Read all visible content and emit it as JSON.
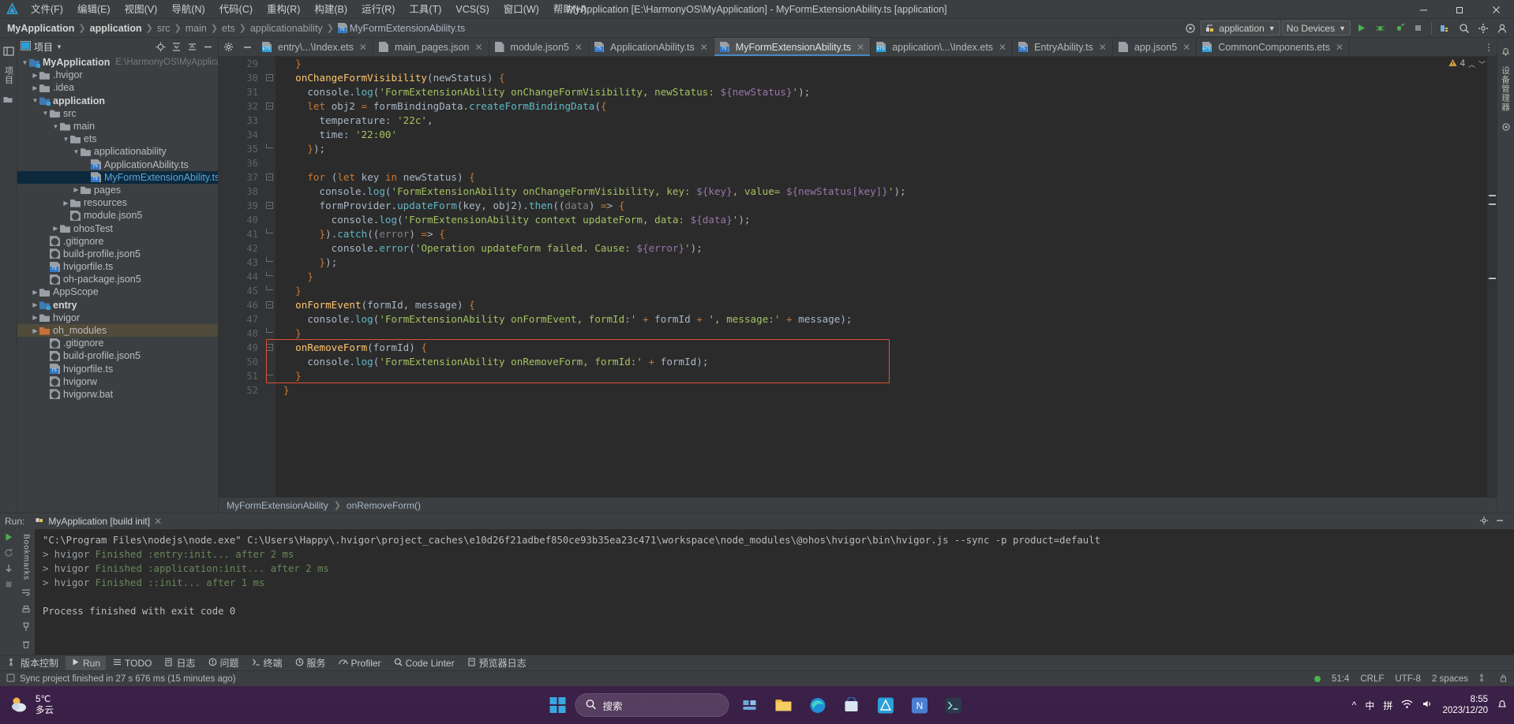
{
  "menu": {
    "logo_icon": "deveco-logo-icon",
    "items": [
      "文件(F)",
      "编辑(E)",
      "视图(V)",
      "导航(N)",
      "代码(C)",
      "重构(R)",
      "构建(B)",
      "运行(R)",
      "工具(T)",
      "VCS(S)",
      "窗口(W)",
      "帮助(H)"
    ],
    "window_title": "MyApplication [E:\\HarmonyOS\\MyApplication] - MyFormExtensionAbility.ts [application]",
    "controls": {
      "minimize": "—",
      "maximize": "❐",
      "close": "✕"
    }
  },
  "navbar": {
    "breadcrumbs": [
      {
        "label": "MyApplication",
        "style": "bold"
      },
      {
        "label": "application",
        "style": "bold"
      },
      {
        "label": "src",
        "style": "dim"
      },
      {
        "label": "main",
        "style": "dim"
      },
      {
        "label": "ets",
        "style": "dim"
      },
      {
        "label": "applicationability",
        "style": "dim"
      },
      {
        "label": "MyFormExtensionAbility.ts",
        "style": "file"
      }
    ],
    "separator": "❯",
    "settings_icon": "gear-toolbar-icon",
    "run_config": "application",
    "device_select": "No Devices",
    "actions": [
      "run-icon",
      "debug-icon",
      "profile-icon",
      "stop-icon",
      "device-manager-icon",
      "search-everywhere-icon",
      "settings-icon",
      "account-icon"
    ]
  },
  "left_rail": {
    "project_tab": "项目",
    "structure_icon": "structure-icon"
  },
  "project": {
    "title": "项目",
    "dropdown_icon": "chevron-down-icon",
    "head_actions": [
      "locate-file-icon",
      "expand-all-icon",
      "collapse-all-icon",
      "hide-icon"
    ],
    "tree": [
      {
        "depth": 0,
        "arrow": "v",
        "type": "folder-module",
        "label": "MyApplication",
        "bold": true,
        "path": "E:\\HarmonyOS\\MyApplication"
      },
      {
        "depth": 1,
        "arrow": ">",
        "type": "folder",
        "label": ".hvigor"
      },
      {
        "depth": 1,
        "arrow": ">",
        "type": "folder",
        "label": ".idea"
      },
      {
        "depth": 1,
        "arrow": "v",
        "type": "folder-module",
        "label": "application",
        "bold": true
      },
      {
        "depth": 2,
        "arrow": "v",
        "type": "folder",
        "label": "src"
      },
      {
        "depth": 3,
        "arrow": "v",
        "type": "folder",
        "label": "main"
      },
      {
        "depth": 4,
        "arrow": "v",
        "type": "folder",
        "label": "ets"
      },
      {
        "depth": 5,
        "arrow": "v",
        "type": "folder",
        "label": "applicationability"
      },
      {
        "depth": 6,
        "arrow": "",
        "type": "ts",
        "label": "ApplicationAbility.ts"
      },
      {
        "depth": 6,
        "arrow": "",
        "type": "ts",
        "label": "MyFormExtensionAbility.ts",
        "selected": true
      },
      {
        "depth": 5,
        "arrow": ">",
        "type": "folder",
        "label": "pages"
      },
      {
        "depth": 4,
        "arrow": ">",
        "type": "folder",
        "label": "resources"
      },
      {
        "depth": 4,
        "arrow": "",
        "type": "json",
        "label": "module.json5"
      },
      {
        "depth": 3,
        "arrow": ">",
        "type": "folder",
        "label": "ohosTest"
      },
      {
        "depth": 2,
        "arrow": "",
        "type": "json",
        "label": ".gitignore"
      },
      {
        "depth": 2,
        "arrow": "",
        "type": "json",
        "label": "build-profile.json5"
      },
      {
        "depth": 2,
        "arrow": "",
        "type": "ts",
        "label": "hvigorfile.ts"
      },
      {
        "depth": 2,
        "arrow": "",
        "type": "json",
        "label": "oh-package.json5"
      },
      {
        "depth": 1,
        "arrow": ">",
        "type": "folder",
        "label": "AppScope"
      },
      {
        "depth": 1,
        "arrow": ">",
        "type": "folder-module",
        "label": "entry",
        "bold": true
      },
      {
        "depth": 1,
        "arrow": ">",
        "type": "folder",
        "label": "hvigor"
      },
      {
        "depth": 1,
        "arrow": ">",
        "type": "folder-orange",
        "label": "oh_modules",
        "selected2": true
      },
      {
        "depth": 2,
        "arrow": "",
        "type": "json",
        "label": ".gitignore"
      },
      {
        "depth": 2,
        "arrow": "",
        "type": "json",
        "label": "build-profile.json5"
      },
      {
        "depth": 2,
        "arrow": "",
        "type": "ts",
        "label": "hvigorfile.ts"
      },
      {
        "depth": 2,
        "arrow": "",
        "type": "json",
        "label": "hvigorw"
      },
      {
        "depth": 2,
        "arrow": "",
        "type": "json",
        "label": "hvigorw.bat"
      }
    ]
  },
  "editor": {
    "tab_ctl_icons": [
      "gear-icon",
      "minimize-icon"
    ],
    "tabs": [
      {
        "label": "entry\\...\\Index.ets",
        "icon": "ets",
        "active": false
      },
      {
        "label": "main_pages.json",
        "icon": "json",
        "active": false
      },
      {
        "label": "module.json5",
        "icon": "json",
        "active": false
      },
      {
        "label": "ApplicationAbility.ts",
        "icon": "ts",
        "active": false
      },
      {
        "label": "MyFormExtensionAbility.ts",
        "icon": "ts",
        "active": true
      },
      {
        "label": "application\\...\\Index.ets",
        "icon": "ets",
        "active": false
      },
      {
        "label": "EntryAbility.ts",
        "icon": "ts",
        "active": false
      },
      {
        "label": "app.json5",
        "icon": "json",
        "active": false
      },
      {
        "label": "CommonComponents.ets",
        "icon": "ets",
        "active": false
      }
    ],
    "tab_more_icon": "more-vertical-icon",
    "warning_count": "4",
    "warning_icon": "warning-triangle-icon",
    "first_line_number": 29,
    "lines": [
      {
        "n": 29,
        "text": "  }",
        "fold": ""
      },
      {
        "n": 30,
        "text": "  onChangeFormVisibility(newStatus) {",
        "fold": "minus"
      },
      {
        "n": 31,
        "text": "    console.log('FormExtensionAbility onChangeFormVisibility, newStatus: ${newStatus}');",
        "fold": ""
      },
      {
        "n": 32,
        "text": "    let obj2 = formBindingData.createFormBindingData({",
        "fold": "minus"
      },
      {
        "n": 33,
        "text": "      temperature: '22c',",
        "fold": ""
      },
      {
        "n": 34,
        "text": "      time: '22:00'",
        "fold": ""
      },
      {
        "n": 35,
        "text": "    });",
        "fold": "end"
      },
      {
        "n": 36,
        "text": "",
        "fold": ""
      },
      {
        "n": 37,
        "text": "    for (let key in newStatus) {",
        "fold": "minus"
      },
      {
        "n": 38,
        "text": "      console.log('FormExtensionAbility onChangeFormVisibility, key: ${key}, value= ${newStatus[key]}');",
        "fold": ""
      },
      {
        "n": 39,
        "text": "      formProvider.updateForm(key, obj2).then((data) => {",
        "fold": "minus"
      },
      {
        "n": 40,
        "text": "        console.log('FormExtensionAbility context updateForm, data: ${data}');",
        "fold": ""
      },
      {
        "n": 41,
        "text": "      }).catch((error) => {",
        "fold": "end"
      },
      {
        "n": 42,
        "text": "        console.error('Operation updateForm failed. Cause: ${error}');",
        "fold": ""
      },
      {
        "n": 43,
        "text": "      });",
        "fold": "end"
      },
      {
        "n": 44,
        "text": "    }",
        "fold": "end"
      },
      {
        "n": 45,
        "text": "  }",
        "fold": "end"
      },
      {
        "n": 46,
        "text": "  onFormEvent(formId, message) {",
        "fold": "minus"
      },
      {
        "n": 47,
        "text": "    console.log('FormExtensionAbility onFormEvent, formId:' + formId + ', message:' + message);",
        "fold": ""
      },
      {
        "n": 48,
        "text": "  }",
        "fold": "end"
      },
      {
        "n": 49,
        "text": "  onRemoveForm(formId) {",
        "fold": "minus"
      },
      {
        "n": 50,
        "text": "    console.log('FormExtensionAbility onRemoveForm, formId:' + formId);",
        "fold": ""
      },
      {
        "n": 51,
        "text": "  }",
        "fold": "end"
      },
      {
        "n": 52,
        "text": "}",
        "fold": ""
      }
    ],
    "highlight_color": "#e0503a",
    "bottom_breadcrumb": [
      "MyFormExtensionAbility",
      "onRemoveForm()"
    ]
  },
  "right_rail": {
    "notifications_icon": "bell-icon",
    "labels": "设备管理器"
  },
  "run_panel": {
    "label": "Run:",
    "tab": "MyApplication [build init]",
    "tab_icon": "run-config-icon",
    "settings_icon": "gear-icon",
    "minimize_icon": "minimize-icon",
    "rail_icons": [
      "run-green-icon",
      "rerun-icon",
      "scroll-down-icon",
      "stop-icon",
      "wrap-icon",
      "print-icon",
      "pin-icon",
      "trash-icon"
    ],
    "console": [
      {
        "text": "\"C:\\Program Files\\nodejs\\node.exe\" C:\\Users\\Happy\\.hvigor\\project_caches\\e10d26f21adbef850ce93b35ea23c471\\workspace\\node_modules\\@ohos\\hvigor\\bin\\hvigor.js --sync -p product=default",
        "style": "plain"
      },
      {
        "text": "> hvigor Finished :entry:init... after 2 ms",
        "style": "green"
      },
      {
        "text": "> hvigor Finished :application:init... after 2 ms",
        "style": "green"
      },
      {
        "text": "> hvigor Finished ::init... after 1 ms",
        "style": "green"
      },
      {
        "text": "",
        "style": "plain"
      },
      {
        "text": "Process finished with exit code 0",
        "style": "plain"
      }
    ]
  },
  "bookmarks_rail": {
    "label": "Bookmarks"
  },
  "tool_windows": [
    {
      "label": "版本控制",
      "icon": "vcs-icon",
      "active": false
    },
    {
      "label": "Run",
      "icon": "run-icon",
      "active": true
    },
    {
      "label": "TODO",
      "icon": "todo-icon",
      "active": false
    },
    {
      "label": "日志",
      "icon": "log-icon",
      "active": false
    },
    {
      "label": "问题",
      "icon": "problems-icon",
      "active": false
    },
    {
      "label": "终端",
      "icon": "terminal-icon",
      "active": false
    },
    {
      "label": "服务",
      "icon": "services-icon",
      "active": false
    },
    {
      "label": "Profiler",
      "icon": "profiler-icon",
      "active": false
    },
    {
      "label": "Code Linter",
      "icon": "linter-icon",
      "active": false
    },
    {
      "label": "预览器日志",
      "icon": "previewer-log-icon",
      "active": false
    }
  ],
  "statusbar": {
    "message_icon": "message-icon",
    "message": "Sync project finished in 27 s 676 ms (15 minutes ago)",
    "caret": "51:4",
    "line_sep": "CRLF",
    "encoding": "UTF-8",
    "indent": "2 spaces",
    "branch_icon": "git-branch-icon",
    "lock_icon": "lock-icon"
  },
  "taskbar": {
    "weather": {
      "temp": "5℃",
      "desc": "多云",
      "icon": "cloud-icon"
    },
    "start_icon": "windows-start-icon",
    "search_placeholder": "搜索",
    "search_icon": "search-icon",
    "apps": [
      "task-view-icon",
      "file-explorer-icon",
      "edge-icon",
      "store-icon",
      "deveco-icon",
      "app-n-icon",
      "terminal-icon"
    ],
    "tray": {
      "chevron": "^",
      "ime": "中",
      "pinyin": "拼",
      "network_icon": "wifi-icon",
      "volume_icon": "volume-icon",
      "time": "8:55",
      "date": "2023/12/20",
      "notify_icon": "notification-icon"
    }
  }
}
